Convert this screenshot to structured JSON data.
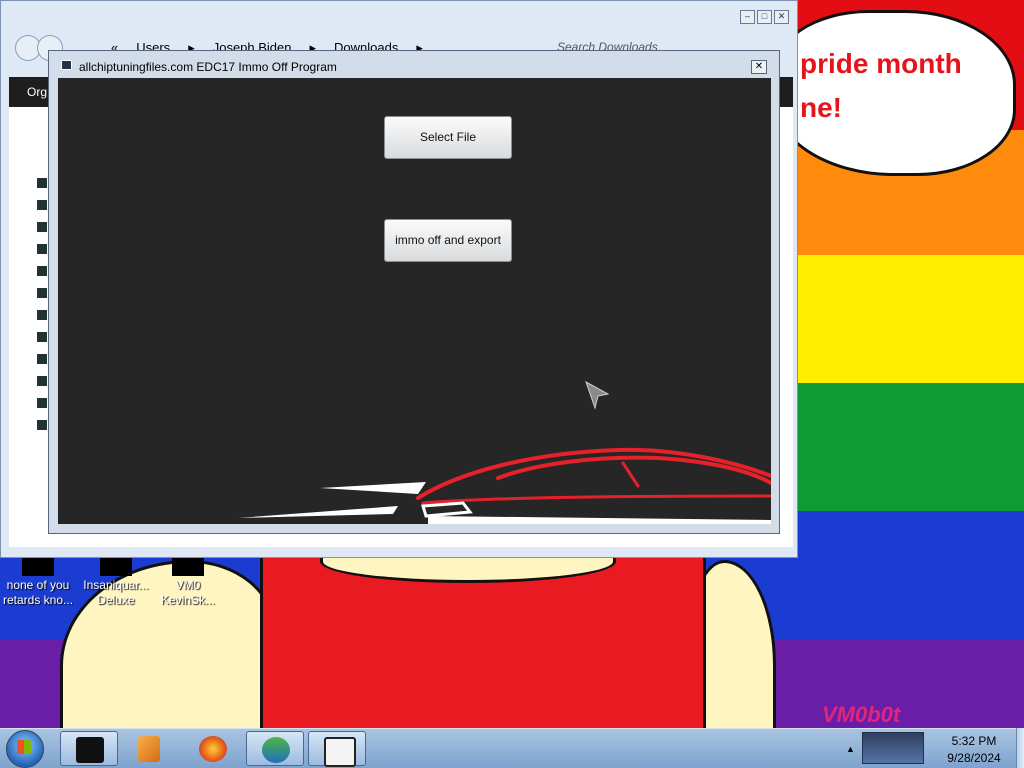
{
  "wallpaper": {
    "bubble_text": "pride month\nne!",
    "watermark": "VM0b0t"
  },
  "desktop_icons": [
    {
      "label": "none of you\nretards kno..."
    },
    {
      "label": "Insaniquar...\nDeluxe"
    },
    {
      "label": "VM0\nKevinSk..."
    }
  ],
  "explorer": {
    "breadcrumbs": [
      "«",
      "Users",
      "▸",
      "Joseph Biden",
      "▸",
      "Downloads",
      "▸"
    ],
    "search_placeholder": "Search Downloads",
    "organize_label": "Org"
  },
  "dialog": {
    "title": "allchiptuningfiles.com EDC17 Immo Off Program",
    "close_glyph": "✕",
    "select_file_label": "Select File",
    "immo_off_label": "immo off and export"
  },
  "taskbar": {
    "clock_time": "5:32 PM",
    "clock_date": "9/28/2024",
    "tray_chevron": "▲"
  },
  "colors": {
    "dialog_bg": "#262626",
    "car_red": "#e5212b",
    "taskbar": "#8fb0d8"
  }
}
